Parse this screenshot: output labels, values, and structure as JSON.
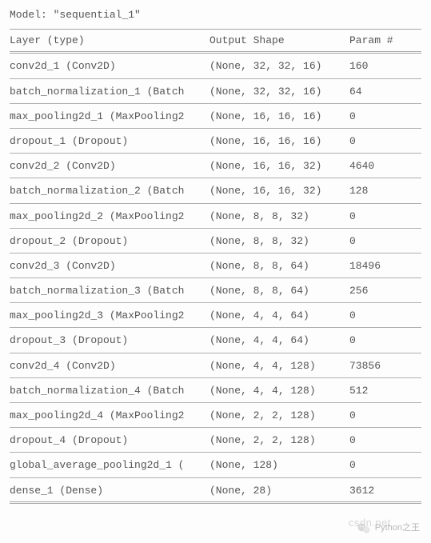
{
  "model_name_label": "Model: \"sequential_1\"",
  "headers": {
    "layer": "Layer (type)",
    "shape": "Output Shape",
    "param": "Param #"
  },
  "rows": [
    {
      "layer": "conv2d_1 (Conv2D)",
      "shape": "(None, 32, 32, 16)",
      "param": "160"
    },
    {
      "layer": "batch_normalization_1 (Batch",
      "shape": "(None, 32, 32, 16)",
      "param": "64"
    },
    {
      "layer": "max_pooling2d_1 (MaxPooling2",
      "shape": "(None, 16, 16, 16)",
      "param": "0"
    },
    {
      "layer": "dropout_1 (Dropout)",
      "shape": "(None, 16, 16, 16)",
      "param": "0"
    },
    {
      "layer": "conv2d_2 (Conv2D)",
      "shape": "(None, 16, 16, 32)",
      "param": "4640"
    },
    {
      "layer": "batch_normalization_2 (Batch",
      "shape": "(None, 16, 16, 32)",
      "param": "128"
    },
    {
      "layer": "max_pooling2d_2 (MaxPooling2",
      "shape": "(None, 8, 8, 32)",
      "param": "0"
    },
    {
      "layer": "dropout_2 (Dropout)",
      "shape": "(None, 8, 8, 32)",
      "param": "0"
    },
    {
      "layer": "conv2d_3 (Conv2D)",
      "shape": "(None, 8, 8, 64)",
      "param": "18496"
    },
    {
      "layer": "batch_normalization_3 (Batch",
      "shape": "(None, 8, 8, 64)",
      "param": "256"
    },
    {
      "layer": "max_pooling2d_3 (MaxPooling2",
      "shape": "(None, 4, 4, 64)",
      "param": "0"
    },
    {
      "layer": "dropout_3 (Dropout)",
      "shape": "(None, 4, 4, 64)",
      "param": "0"
    },
    {
      "layer": "conv2d_4 (Conv2D)",
      "shape": "(None, 4, 4, 128)",
      "param": "73856"
    },
    {
      "layer": "batch_normalization_4 (Batch",
      "shape": "(None, 4, 4, 128)",
      "param": "512"
    },
    {
      "layer": "max_pooling2d_4 (MaxPooling2",
      "shape": "(None, 2, 2, 128)",
      "param": "0"
    },
    {
      "layer": "dropout_4 (Dropout)",
      "shape": "(None, 2, 2, 128)",
      "param": "0"
    },
    {
      "layer": "global_average_pooling2d_1 (",
      "shape": "(None, 128)",
      "param": "0"
    },
    {
      "layer": "dense_1 (Dense)",
      "shape": "(None, 28)",
      "param": "3612"
    }
  ],
  "watermark_faint": "csdn.net",
  "wx_label": "Python之王"
}
